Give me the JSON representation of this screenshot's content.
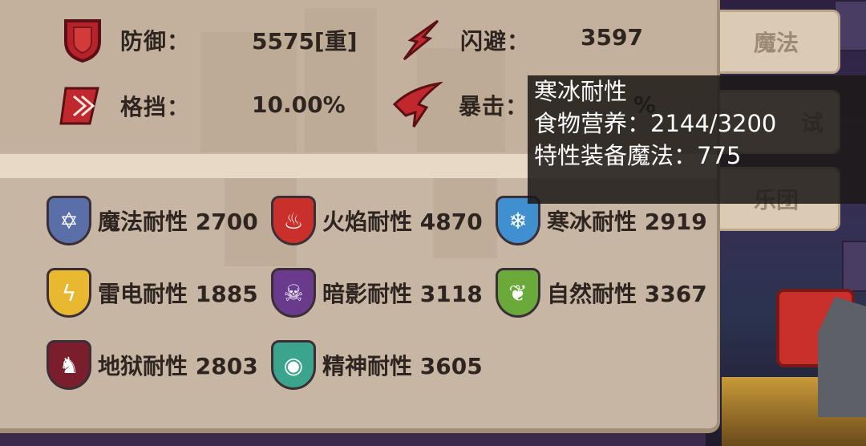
{
  "side_tabs": [
    {
      "label": "魔法"
    },
    {
      "label": "试"
    },
    {
      "label": "乐团"
    }
  ],
  "stats": {
    "defense": {
      "label": "防御：",
      "value": "5575[重]",
      "icon": "red-shield-icon"
    },
    "dodge": {
      "label": "闪避：",
      "value": "3597",
      "icon": "red-dash-icon"
    },
    "block": {
      "label": "格挡：",
      "value": "10.00%",
      "icon": "red-block-icon"
    },
    "crit": {
      "label": "暴击：",
      "value": "%",
      "icon": "red-claw-icon"
    }
  },
  "resistances": [
    {
      "label": "魔法耐性 2700",
      "icon": "hexagram-icon",
      "color": "#5a6fa8"
    },
    {
      "label": "火焰耐性 4870",
      "icon": "flame-icon",
      "color": "#c9302c"
    },
    {
      "label": "寒冰耐性 2919",
      "icon": "snowflake-icon",
      "color": "#3f8fd1"
    },
    {
      "label": "雷电耐性 1885",
      "icon": "lightning-icon",
      "color": "#e8b830"
    },
    {
      "label": "暗影耐性 3118",
      "icon": "skull-icon",
      "color": "#6a3a8c"
    },
    {
      "label": "自然耐性 3367",
      "icon": "leaf-flame-icon",
      "color": "#6aaa3a"
    },
    {
      "label": "地狱耐性 2803",
      "icon": "hell-beast-icon",
      "color": "#7a1e2e"
    },
    {
      "label": "精神耐性 3605",
      "icon": "eye-icon",
      "color": "#3aa58c"
    }
  ],
  "tooltip": {
    "title": "寒冰耐性",
    "line1": "食物营养：2144/3200",
    "line2": "特性装备魔法：775"
  }
}
